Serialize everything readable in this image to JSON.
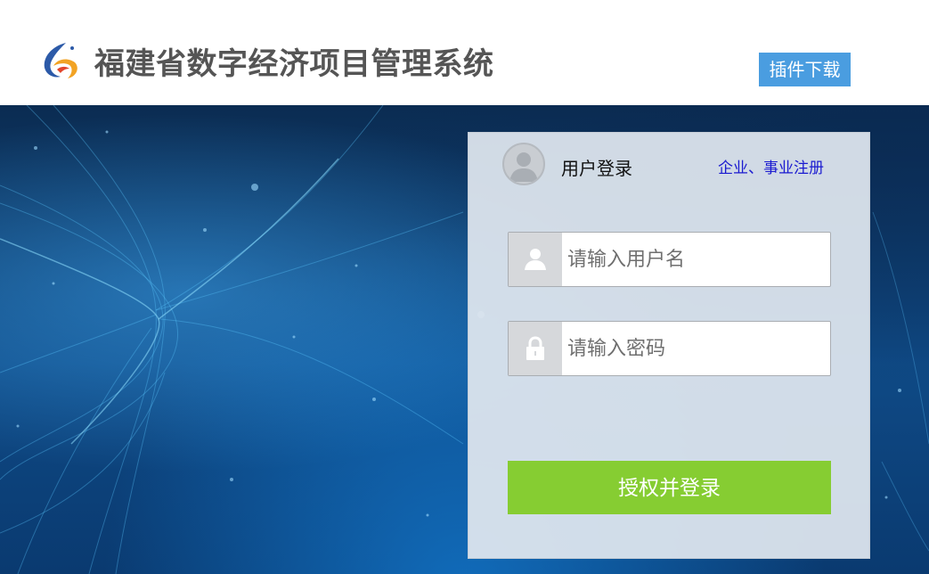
{
  "header": {
    "title": "福建省数字经济项目管理系统",
    "plugin_download_label": "插件下载"
  },
  "login": {
    "title": "用户登录",
    "register_link": "企业、事业注册",
    "username_placeholder": "请输入用户名",
    "password_placeholder": "请输入密码",
    "submit_label": "授权并登录"
  },
  "colors": {
    "plugin_button": "#4a9de0",
    "login_button": "#86cd32",
    "register_link": "#1a1ad0",
    "title_text": "#555555"
  },
  "icons": {
    "logo": "swirl-logo-icon",
    "avatar": "user-avatar-icon",
    "username": "user-icon",
    "password": "lock-icon"
  }
}
